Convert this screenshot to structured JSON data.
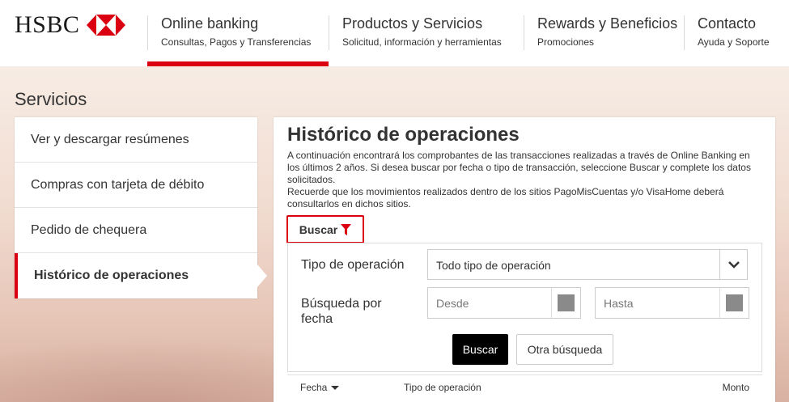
{
  "brand": {
    "name": "HSBC",
    "colors": {
      "red": "#db0011",
      "dark": "#333333"
    }
  },
  "nav": [
    {
      "title": "Online banking",
      "subtitle": "Consultas, Pagos y Transferencias",
      "active": true
    },
    {
      "title": "Productos y Servicios",
      "subtitle": "Solicitud, información y herramientas"
    },
    {
      "title": "Rewards y Beneficios",
      "subtitle": "Promociones"
    },
    {
      "title": "Contacto",
      "subtitle": "Ayuda y Soporte"
    }
  ],
  "section_title": "Servicios",
  "sidebar": {
    "items": [
      {
        "label": "Ver y descargar resúmenes"
      },
      {
        "label": "Compras con tarjeta de débito"
      },
      {
        "label": "Pedido de chequera"
      },
      {
        "label": "Histórico de operaciones",
        "active": true
      }
    ]
  },
  "main": {
    "title": "Histórico de operaciones",
    "description_1": "A continuación encontrará los comprobantes de las transacciones realizadas a través de Online Banking en los últimos 2 años. Si desea buscar por fecha o tipo de transacción, seleccione Buscar y complete los datos solicitados.",
    "description_2": "Recuerde que los movimientos realizados dentro de los sitios PagoMisCuentas y/o VisaHome deberá consultarlos en dichos sitios.",
    "search_toggle_label": "Buscar",
    "search_toggle_icon": "funnel-icon",
    "form": {
      "operation_type_label": "Tipo de operación",
      "operation_type_value": "Todo tipo de operación",
      "date_label": "Búsqueda por fecha",
      "from_placeholder": "Desde",
      "separator": "-",
      "to_placeholder": "Hasta",
      "search_button": "Buscar",
      "reset_button": "Otra búsqueda"
    },
    "table": {
      "columns": [
        "Fecha",
        "Tipo de operación",
        "Monto"
      ]
    }
  }
}
